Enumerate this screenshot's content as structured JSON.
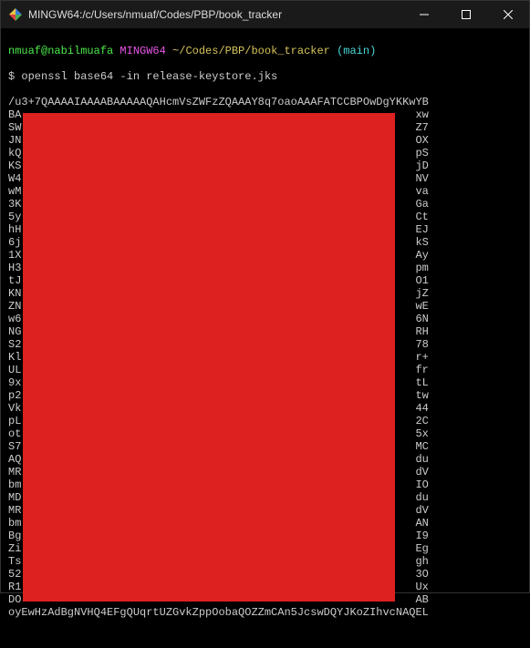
{
  "window": {
    "title": "MINGW64:/c/Users/nmuaf/Codes/PBP/book_tracker"
  },
  "prompt": {
    "user_host": "nmuaf@nabilmuafa",
    "shell": "MINGW64",
    "cwd": "~/Codes/PBP/book_tracker",
    "branch": "(main)",
    "symbol": "$",
    "command": "openssl base64 -in release-keystore.jks"
  },
  "output": [
    "/u3+7QAAAAIAAAABAAAAAQAHcmVsZWFzZQAAAY8q7oaoAAAFATCCBPOwDgYKKwYB",
    "BA                                                            xw",
    "SW                                                            Z7",
    "JN                                                            OX",
    "kQ                                                            pS",
    "KS                                                            jD",
    "W4                                                            NV",
    "wM                                                            va",
    "3K                                                            Ga",
    "5y                                                            Ct",
    "hH                                                            EJ",
    "6j                                                            kS",
    "1X                                                            Ay",
    "H3                                                            pm",
    "tJ                                                            O1",
    "KN                                                            jZ",
    "ZN                                                            wE",
    "w6                                                            6N",
    "NG                                                            RH",
    "S2                                                            78",
    "Kl                                                            r+",
    "UL                                                            fr",
    "9x                                                            tL",
    "p2                                                            tw",
    "Vk                                                            44",
    "pL                                                            2C",
    "ot                                                            5x",
    "S7                                                            MC",
    "AQ                                                            du",
    "MR                                                            dV",
    "bm                                                            IO",
    "MD                                                            du",
    "MR                                                            dV",
    "bm                                                            AN",
    "Bg                                                            I9",
    "Zi                                                            Eg",
    "Ts                                                            gh",
    "52                                                            3O",
    "R1                                                            Ux",
    "DO                                                            AB",
    "oyEwHzAdBgNVHQ4EFgQUqrtUZGvkZppOobaQOZZmCAn5JcswDQYJKoZIhvcNAQEL"
  ]
}
